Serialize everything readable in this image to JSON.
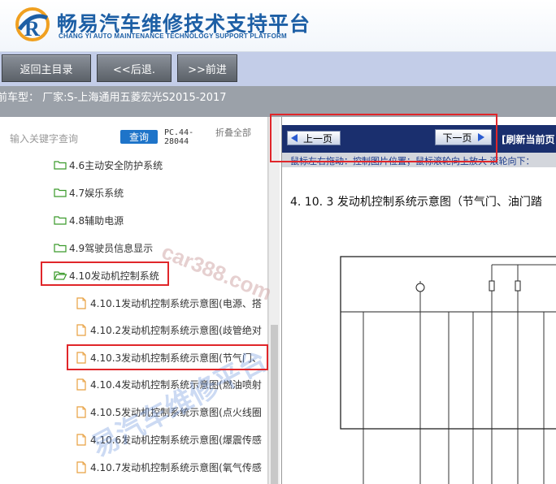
{
  "header": {
    "title": "畅易汽车维修技术支持平台",
    "subtitle": "CHANG YI AUTO MAINTENANCE TECHNOLOGY SUPPORT PLATFORM"
  },
  "nav": {
    "home": "返回主目录",
    "back": "<<后退.",
    "forward": ">>前进"
  },
  "car_info": "前车型： 厂家:S-上海通用五菱宏光S2015-2017",
  "search": {
    "label": "输入关键字查询",
    "button": "查询",
    "code": "PC.44-28044",
    "collapse": "折叠全部"
  },
  "tree": {
    "folders": [
      "4.6主动安全防护系统",
      "4.7娱乐系统",
      "4.8辅助电源",
      "4.9驾驶员信息显示",
      "4.10发动机控制系统"
    ],
    "docs": [
      "4.10.1发动机控制系统示意图(电源、搭",
      "4.10.2发动机控制系统示意图(歧管绝对",
      "4.10.3发动机控制系统示意图(节气门、",
      "4.10.4发动机控制系统示意图(燃油喷射",
      "4.10.5发动机控制系统示意图(点火线圈",
      "4.10.6发动机控制系统示意图(爆震传感",
      "4.10.7发动机控制系统示意图(氧气传感"
    ]
  },
  "viewer": {
    "prev": "上一页",
    "next": "下一页",
    "refresh": "[刷新当前页",
    "hint": "鼠标左右拖动：控制图片位置；鼠标滚轮向上放大  滚轮向下：",
    "diagram_title": "4. 10. 3 发动机控制系统示意图（节气门、油门踏"
  },
  "watermarks": {
    "site": "car388.com",
    "brand": "易汽车维修平台"
  },
  "colors": {
    "brand_blue": "#1d5fa5",
    "nav_bg": "#c3cde8",
    "viewer_bar": "#1a2f6e",
    "highlight_red": "#e0262a"
  }
}
